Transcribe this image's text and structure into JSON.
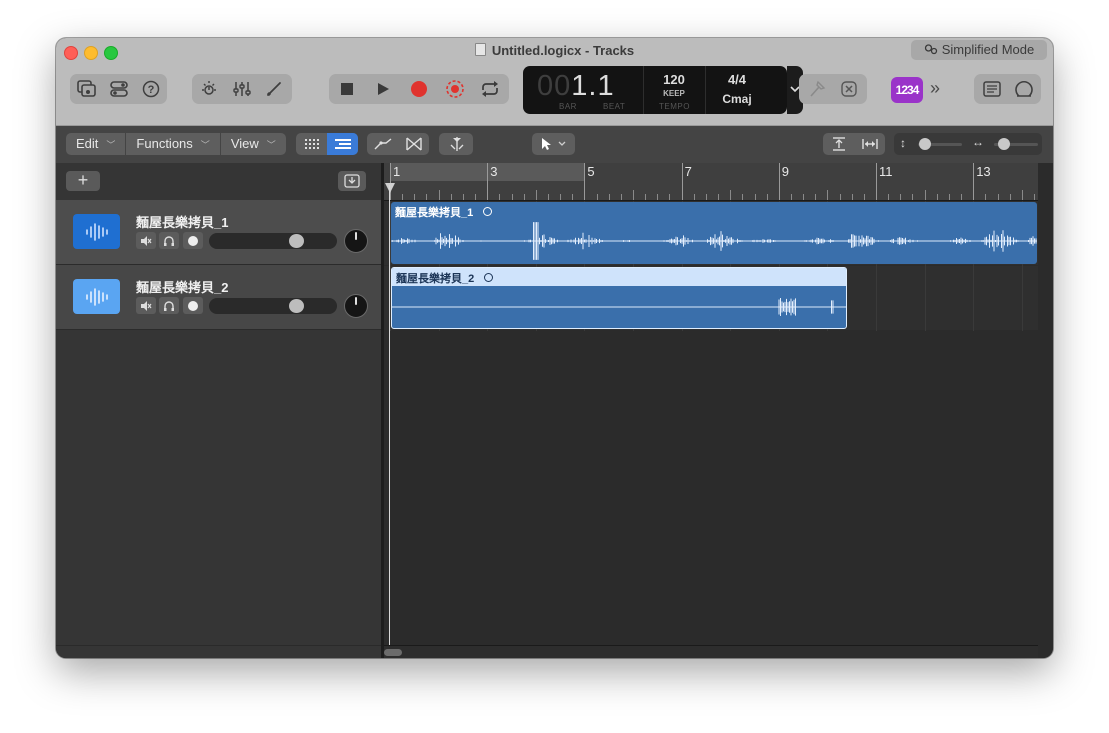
{
  "window": {
    "title": "Untitled.logicx - Tracks",
    "simplified_mode_label": "Simplified Mode"
  },
  "toolbar": {
    "left_icons": [
      "library-icon",
      "inspector-icon",
      "quick-help-icon"
    ],
    "mid_icons": [
      "smart-controls-icon",
      "mixer-icon",
      "editors-icon"
    ],
    "transport_icons": [
      "stop-icon",
      "play-icon",
      "record-icon",
      "capture-record-icon",
      "cycle-icon"
    ],
    "right_icons": [
      "tuner-icon",
      "metronome-off-icon"
    ],
    "far_right_icons": [
      "note-pad-icon",
      "apple-loops-icon"
    ],
    "count_in_label": "1234",
    "more_label": "»"
  },
  "lcd": {
    "position_dim": "00",
    "position_bar": "1",
    "position_sep": ".",
    "position_beat": "1",
    "bar_label": "BAR",
    "beat_label": "BEAT",
    "tempo": "120",
    "tempo_mode": "KEEP",
    "tempo_label": "TEMPO",
    "time_signature": "4/4",
    "key": "Cmaj"
  },
  "editbar": {
    "menus": [
      {
        "label": "Edit"
      },
      {
        "label": "Functions"
      },
      {
        "label": "View"
      }
    ],
    "view_mode_icons": [
      "grid-view-icon",
      "list-view-icon"
    ],
    "automation_icons": [
      "automation-icon",
      "flex-icon"
    ],
    "snap_icon": "catch-playhead-icon",
    "pointer_tool_icon": "pointer-tool-icon",
    "zoom_icons": [
      "fit-vertical-icon",
      "fit-horizontal-icon"
    ],
    "vertical_zoom_icon": "vertical-zoom-icon",
    "horizontal_zoom_icon": "horizontal-zoom-icon",
    "vertical_zoom_level": 0.05,
    "horizontal_zoom_level": 0.2
  },
  "track_header": {
    "add_label": "+",
    "catch_icon": "catch-content-icon"
  },
  "tracks": [
    {
      "name": "麵屋長樂拷貝_1",
      "icon": "waveform-icon",
      "icon_color": "#1f6fd1",
      "volume": 0.71,
      "pan": 0
    },
    {
      "name": "麵屋長樂拷貝_2",
      "icon": "waveform-icon",
      "icon_color": "#5aa5f2",
      "volume": 0.71,
      "pan": 0
    }
  ],
  "ruler": {
    "bar_labels": [
      "1",
      "3",
      "5",
      "7",
      "9",
      "11",
      "13"
    ],
    "cycle_start_bar": 1,
    "cycle_end_bar": 5
  },
  "regions": [
    {
      "name": "麵屋長樂拷貝_1",
      "color": "#3a6fab",
      "start_bar": 1,
      "end_bar": 14.5
    },
    {
      "name": "麵屋長樂拷貝_2",
      "color": "#3a6fab",
      "header_color": "#cfe3fb",
      "start_bar": 1,
      "end_bar": 10.4
    }
  ],
  "colors": {
    "accent": "#3a7bd8",
    "record": "#e0332e",
    "count_in": "#9a33c9"
  }
}
